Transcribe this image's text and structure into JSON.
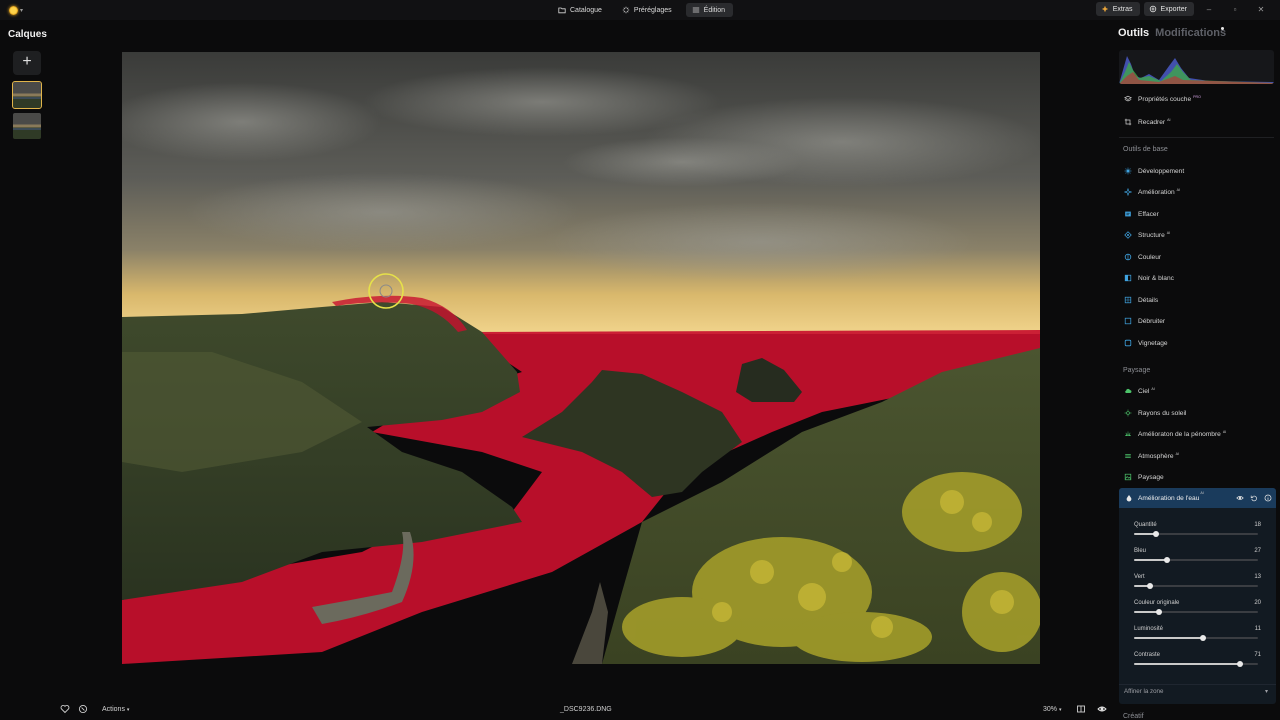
{
  "topbar": {
    "tabs": [
      {
        "label": "Catalogue",
        "icon": "folder-icon"
      },
      {
        "label": "Préréglages",
        "icon": "presets-icon"
      },
      {
        "label": "Édition",
        "icon": "sliders-icon"
      }
    ],
    "active_tab": "Édition",
    "extras_label": "Extras",
    "export_label": "Exporter"
  },
  "layers": {
    "title": "Calques",
    "count": 2
  },
  "bottombar": {
    "actions_label": "Actions",
    "filename": "_DSC9236.DNG",
    "zoom": "30%"
  },
  "panel": {
    "tab_tools": "Outils",
    "tab_changes": "Modifications",
    "top_items": [
      {
        "label": "Propriétés couche",
        "tag": "PRO",
        "icon": "layers-icon"
      },
      {
        "label": "Recadrer",
        "tag": "AI",
        "icon": "crop-icon"
      }
    ],
    "section_basic": "Outils de base",
    "basic_items": [
      {
        "label": "Développement",
        "tag": "",
        "icon": "sun-icon"
      },
      {
        "label": "Amélioration",
        "tag": "AI",
        "icon": "sparkle-icon"
      },
      {
        "label": "Effacer",
        "tag": "",
        "icon": "eraser-icon"
      },
      {
        "label": "Structure",
        "tag": "AI",
        "icon": "structure-icon"
      },
      {
        "label": "Couleur",
        "tag": "",
        "icon": "color-drop-icon"
      },
      {
        "label": "Noir & blanc",
        "tag": "",
        "icon": "bw-icon"
      },
      {
        "label": "Détails",
        "tag": "",
        "icon": "details-icon"
      },
      {
        "label": "Débruiter",
        "tag": "",
        "icon": "denoise-icon"
      },
      {
        "label": "Vignetage",
        "tag": "",
        "icon": "vignette-icon"
      }
    ],
    "section_landscape": "Paysage",
    "landscape_items": [
      {
        "label": "Ciel",
        "tag": "AI",
        "icon": "cloud-icon"
      },
      {
        "label": "Rayons du soleil",
        "tag": "",
        "icon": "sunrays-icon"
      },
      {
        "label": "Amélioraton de la pénombre",
        "tag": "AI",
        "icon": "golden-hour-icon"
      },
      {
        "label": "Atmosphère",
        "tag": "AI",
        "icon": "atmosphere-icon"
      },
      {
        "label": "Paysage",
        "tag": "",
        "icon": "landscape-icon"
      }
    ],
    "active_tool": {
      "label": "Amélioration de l'eau",
      "tag": "AI",
      "sliders": [
        {
          "label": "Quantité",
          "value": 18,
          "min": 0,
          "max": 100
        },
        {
          "label": "Bleu",
          "value": 27,
          "min": 0,
          "max": 100
        },
        {
          "label": "Vert",
          "value": 13,
          "min": 0,
          "max": 100
        },
        {
          "label": "Couleur originale",
          "value": 20,
          "min": 0,
          "max": 100
        },
        {
          "label": "Luminosité",
          "value": 11,
          "min": -100,
          "max": 100
        },
        {
          "label": "Contraste",
          "value": 71,
          "min": -100,
          "max": 100
        }
      ]
    },
    "refine_label": "Affiner la zone",
    "section_creative": "Créatif"
  },
  "colors": {
    "accent": "#e0b44a",
    "active_header": "#1a3b5c",
    "mask_overlay": "#c8102e"
  }
}
